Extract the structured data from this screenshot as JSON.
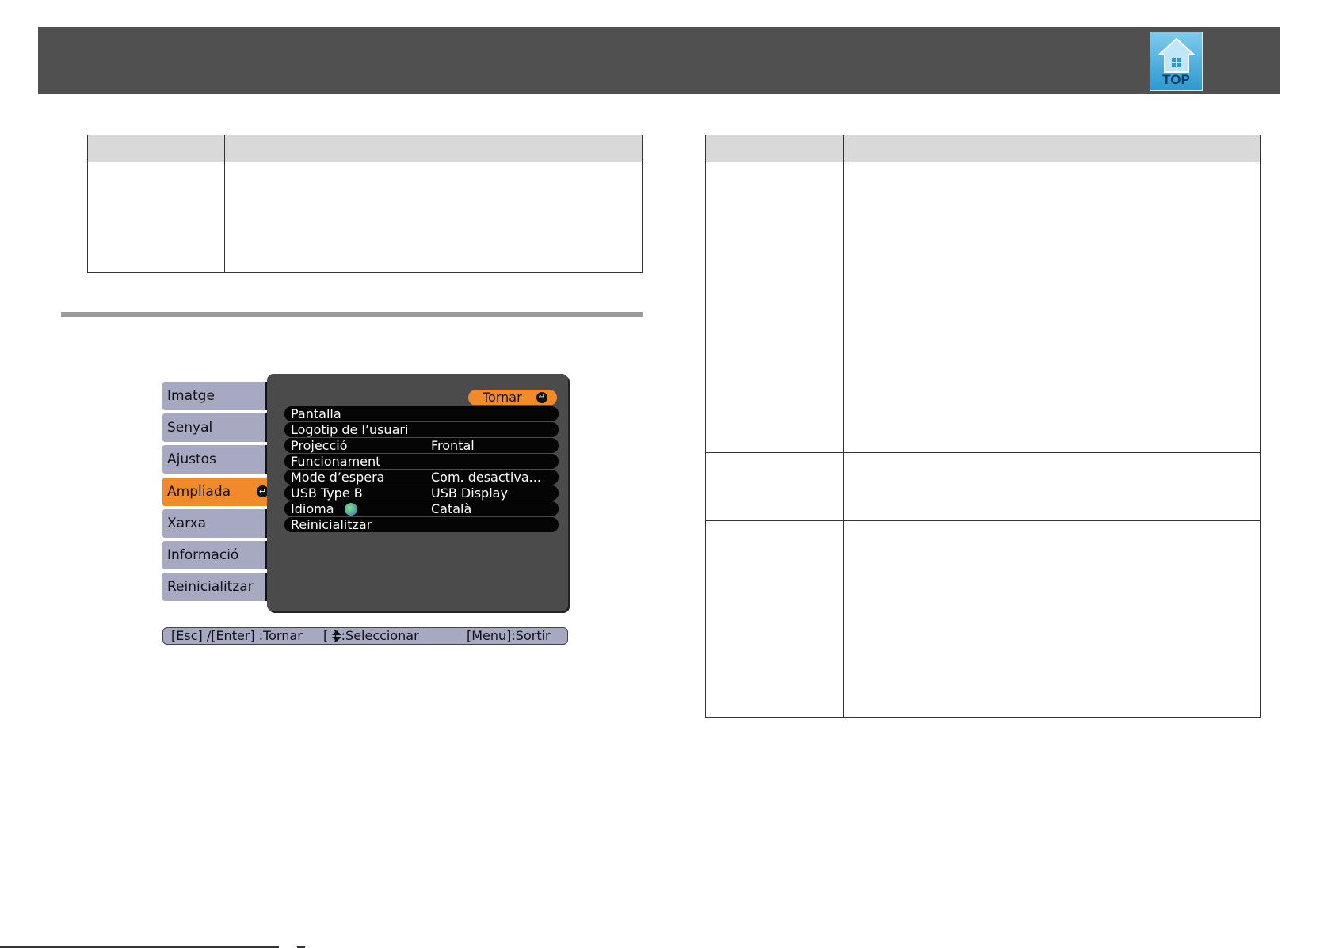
{
  "top_button": {
    "label": "TOP",
    "icon": "home-icon"
  },
  "osd": {
    "tabs": [
      {
        "label": "Imatge"
      },
      {
        "label": "Senyal"
      },
      {
        "label": "Ajustos"
      },
      {
        "label": "Ampliada",
        "active": true
      },
      {
        "label": "Xarxa"
      },
      {
        "label": "Informació"
      },
      {
        "label": "Reinicialitzar"
      }
    ],
    "back_label": "Tornar",
    "items": [
      {
        "label": "Pantalla",
        "value": ""
      },
      {
        "label": "Logotip de l’usuari",
        "value": ""
      },
      {
        "label": "Projecció",
        "value": "Frontal"
      },
      {
        "label": "Funcionament",
        "value": ""
      },
      {
        "label": "Mode d’espera",
        "value": "Com. desactiva..."
      },
      {
        "label": "USB Type B",
        "value": "USB Display"
      },
      {
        "label": "Idioma",
        "value": "Català"
      },
      {
        "label": "Reinicialitzar",
        "value": ""
      }
    ],
    "status": {
      "esc_enter": "[Esc] /[Enter] :Tornar",
      "select": "[ ] :Seleccionar",
      "menu": "[Menu]:Sortir"
    }
  },
  "colors": {
    "header": "#505050",
    "tab": "#a7a8c2",
    "active": "#f08a2a",
    "panel": "#4b4b4b"
  }
}
